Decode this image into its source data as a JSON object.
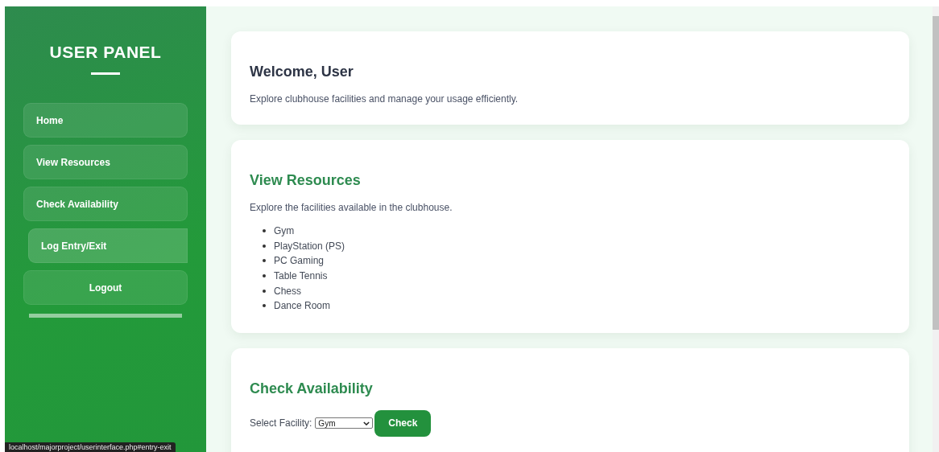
{
  "sidebar": {
    "title": "USER PANEL",
    "items": [
      {
        "label": "Home",
        "kind": "link",
        "hovered": false
      },
      {
        "label": "View Resources",
        "kind": "link",
        "hovered": false
      },
      {
        "label": "Check Availability",
        "kind": "link",
        "hovered": false
      },
      {
        "label": "Log Entry/Exit",
        "kind": "link",
        "hovered": true
      },
      {
        "label": "Logout",
        "kind": "logout",
        "hovered": false
      }
    ]
  },
  "welcome": {
    "title": "Welcome, User",
    "text": "Explore clubhouse facilities and manage your usage efficiently."
  },
  "resources": {
    "title": "View Resources",
    "text": "Explore the facilities available in the clubhouse.",
    "items": [
      "Gym",
      "PlayStation (PS)",
      "PC Gaming",
      "Table Tennis",
      "Chess",
      "Dance Room"
    ]
  },
  "availability": {
    "title": "Check Availability",
    "label": "Select Facility:",
    "select_value": "Gym",
    "button": "Check"
  },
  "status_url": "localhost/majorproject/userinterface.php#entry-exit"
}
